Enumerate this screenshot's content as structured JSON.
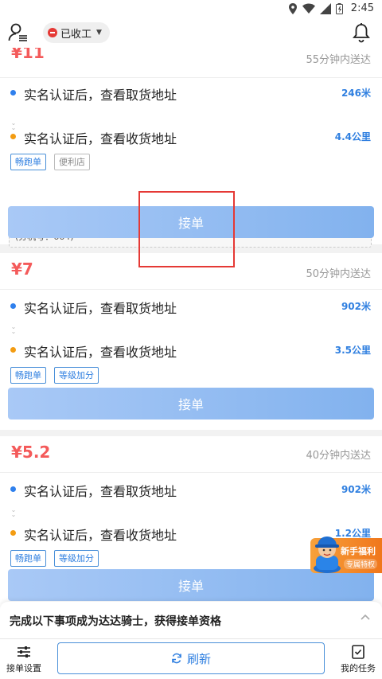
{
  "status_bar": {
    "time": "2:45"
  },
  "header": {
    "status_label": "已收工",
    "status_color": "#e53935"
  },
  "orders": [
    {
      "price": "¥11",
      "eta": "55分钟内送达",
      "pickup": {
        "text": "实名认证后，查看取货地址",
        "distance": "246米"
      },
      "dropoff": {
        "text": "实名认证后，查看收货地址",
        "distance": "4.4公里"
      },
      "tags": [
        "畅跑单",
        "便利店"
      ],
      "extension": "(分机号：664)",
      "accept_label": "接单"
    },
    {
      "price": "¥7",
      "eta": "50分钟内送达",
      "pickup": {
        "text": "实名认证后，查看取货地址",
        "distance": "902米"
      },
      "dropoff": {
        "text": "实名认证后，查看收货地址",
        "distance": "3.5公里"
      },
      "tags": [
        "畅跑单",
        "等级加分"
      ],
      "accept_label": "接单"
    },
    {
      "price": "¥5.2",
      "eta": "40分钟内送达",
      "pickup": {
        "text": "实名认证后，查看取货地址",
        "distance": "902米"
      },
      "dropoff": {
        "text": "实名认证后，查看收货地址",
        "distance": "1.2公里"
      },
      "tags": [
        "畅跑单",
        "等级加分"
      ],
      "accept_label": "接单"
    }
  ],
  "promo": {
    "title": "新手福利",
    "subtitle": "专属特权"
  },
  "qualification_banner": {
    "text": "完成以下事项成为达达骑士，获得接单资格"
  },
  "bottom_bar": {
    "left_label": "接单设置",
    "refresh_label": "刷新",
    "right_label": "我的任务"
  },
  "colors": {
    "price": "#f45a5a",
    "distance": "#2f7fe0",
    "pickup_dot": "#2f80ed",
    "dropoff_dot": "#f39c12",
    "accent": "#4a90d9"
  }
}
